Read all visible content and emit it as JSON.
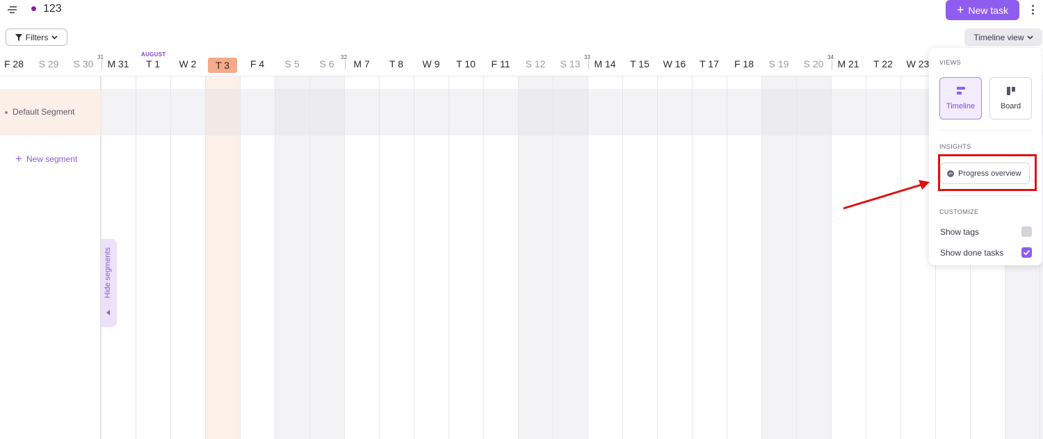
{
  "topbar": {
    "menu_icon": "menu-icon",
    "project_name": "123",
    "project_color": "#8a1e9a",
    "new_task_label": "New task",
    "more_icon": "kebab-icon"
  },
  "filters": {
    "label": "Filters"
  },
  "view_switcher": {
    "label": "Timeline view"
  },
  "timeline": {
    "month_label": "AUGUST",
    "days": [
      {
        "label": "F 28",
        "weekend": false
      },
      {
        "label": "S 29",
        "weekend": true
      },
      {
        "label": "S 30",
        "weekend": true
      },
      {
        "label": "M 31",
        "weekend": false,
        "week": "31"
      },
      {
        "label": "T 1",
        "weekend": false,
        "month": true
      },
      {
        "label": "W 2",
        "weekend": false
      },
      {
        "label": "T 3",
        "weekend": false,
        "today": true
      },
      {
        "label": "F 4",
        "weekend": false
      },
      {
        "label": "S 5",
        "weekend": true
      },
      {
        "label": "S 6",
        "weekend": true
      },
      {
        "label": "M 7",
        "weekend": false,
        "week": "32"
      },
      {
        "label": "T 8",
        "weekend": false
      },
      {
        "label": "W 9",
        "weekend": false
      },
      {
        "label": "T 10",
        "weekend": false
      },
      {
        "label": "F 11",
        "weekend": false
      },
      {
        "label": "S 12",
        "weekend": true
      },
      {
        "label": "S 13",
        "weekend": true
      },
      {
        "label": "M 14",
        "weekend": false,
        "week": "33"
      },
      {
        "label": "T 15",
        "weekend": false
      },
      {
        "label": "W 16",
        "weekend": false
      },
      {
        "label": "T 17",
        "weekend": false
      },
      {
        "label": "F 18",
        "weekend": false
      },
      {
        "label": "S 19",
        "weekend": true
      },
      {
        "label": "S 20",
        "weekend": true
      },
      {
        "label": "M 21",
        "weekend": false,
        "week": "34"
      },
      {
        "label": "T 22",
        "weekend": false
      },
      {
        "label": "W 23",
        "weekend": false
      }
    ],
    "today_color": "#f4aa8c",
    "accent_color": "#8f5cf0"
  },
  "sidebar": {
    "segment_name": "Default Segment",
    "new_segment_label": "New segment",
    "hide_segments_label": "Hide segments"
  },
  "popover": {
    "views_title": "VIEWS",
    "view_timeline_label": "Timeline",
    "view_board_label": "Board",
    "insights_title": "INSIGHTS",
    "progress_overview_label": "Progress overview",
    "customize_title": "CUSTOMIZE",
    "show_tags_label": "Show tags",
    "show_tags_checked": false,
    "show_done_tasks_label": "Show done tasks",
    "show_done_tasks_checked": true
  },
  "annotation": {
    "color": "#e01010"
  }
}
